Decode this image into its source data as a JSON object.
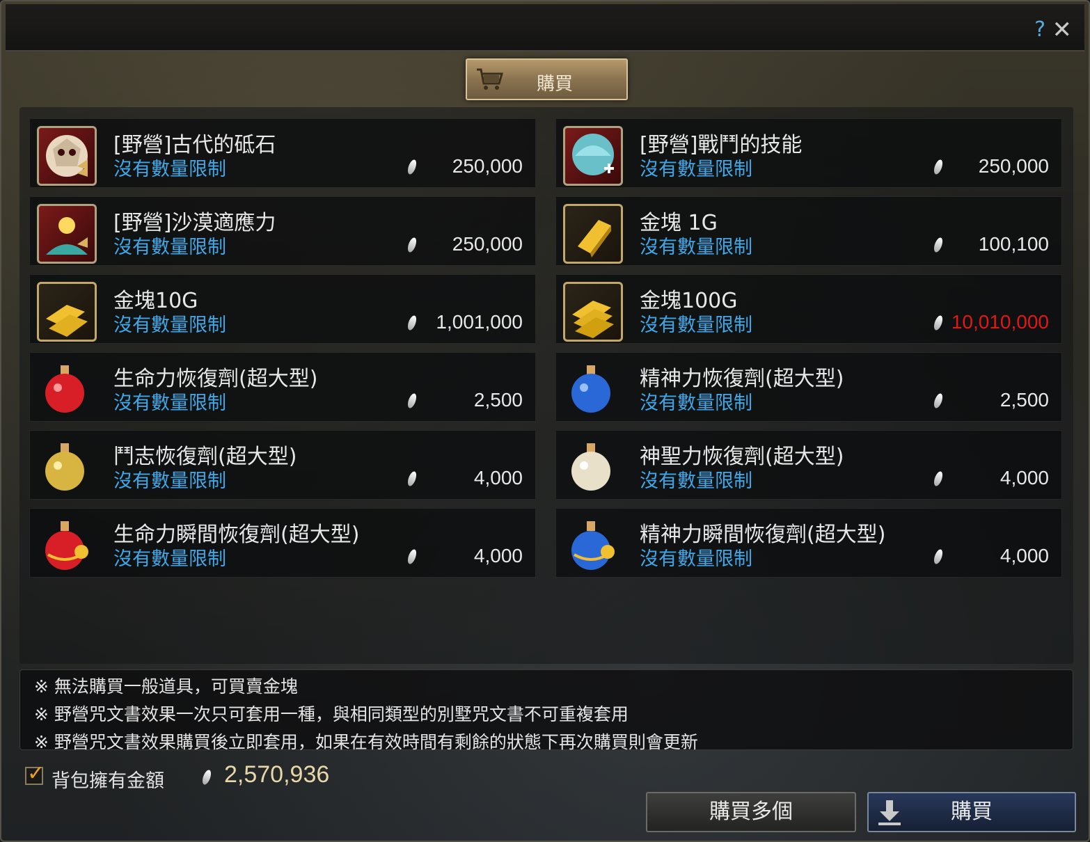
{
  "window": {
    "help_glyph": "?",
    "close_glyph": "✕"
  },
  "tab": {
    "label": "購買",
    "icon": "cart-icon"
  },
  "items": [
    {
      "name": "[野營]古代的砥石",
      "limit": "沒有數量限制",
      "price": "250,000",
      "icon": "beast-skull-icon",
      "frame": "red"
    },
    {
      "name": "[野營]戰鬥的技能",
      "limit": "沒有數量限制",
      "price": "250,000",
      "icon": "shield-heal-icon",
      "frame": "red"
    },
    {
      "name": "[野營]沙漠適應力",
      "limit": "沒有數量限制",
      "price": "250,000",
      "icon": "desert-sun-icon",
      "frame": "red"
    },
    {
      "name": "金塊 1G",
      "limit": "沒有數量限制",
      "price": "100,100",
      "icon": "gold-bar-icon",
      "frame": "gold"
    },
    {
      "name": "金塊10G",
      "limit": "沒有數量限制",
      "price": "1,001,000",
      "icon": "gold-bars-icon",
      "frame": "gold"
    },
    {
      "name": "金塊100G",
      "limit": "沒有數量限制",
      "price": "10,010,000",
      "icon": "gold-bars-stack-icon",
      "frame": "gold",
      "price_color": "#e01818"
    },
    {
      "name": "生命力恢復劑(超大型)",
      "limit": "沒有數量限制",
      "price": "2,500",
      "icon": "red-potion-icon",
      "frame": "none"
    },
    {
      "name": "精神力恢復劑(超大型)",
      "limit": "沒有數量限制",
      "price": "2,500",
      "icon": "blue-potion-icon",
      "frame": "none"
    },
    {
      "name": "鬥志恢復劑(超大型)",
      "limit": "沒有數量限制",
      "price": "4,000",
      "icon": "yellow-potion-icon",
      "frame": "none"
    },
    {
      "name": "神聖力恢復劑(超大型)",
      "limit": "沒有數量限制",
      "price": "4,000",
      "icon": "white-potion-icon",
      "frame": "none"
    },
    {
      "name": "生命力瞬間恢復劑(超大型)",
      "limit": "沒有數量限制",
      "price": "4,000",
      "icon": "red-instant-potion-icon",
      "frame": "none"
    },
    {
      "name": "精神力瞬間恢復劑(超大型)",
      "limit": "沒有數量限制",
      "price": "4,000",
      "icon": "blue-instant-potion-icon",
      "frame": "none"
    }
  ],
  "notes": [
    "※ 無法購買一般道具，可買賣金塊",
    "※ 野營咒文書效果一次只可套用一種，與相同類型的別墅咒文書不可重複套用",
    "※ 野營咒文書效果購買後立即套用，如果在有效時間有剩餘的狀態下再次購買則會更新"
  ],
  "inventory": {
    "label": "背包擁有金額",
    "amount": "2,570,936",
    "checked": true
  },
  "buttons": {
    "buy_multiple": "購買多個",
    "buy": "購買"
  },
  "colors": {
    "limit_text": "#3ea8e8",
    "price_over_budget": "#e01818",
    "accent_gold": "#c4a86a"
  }
}
